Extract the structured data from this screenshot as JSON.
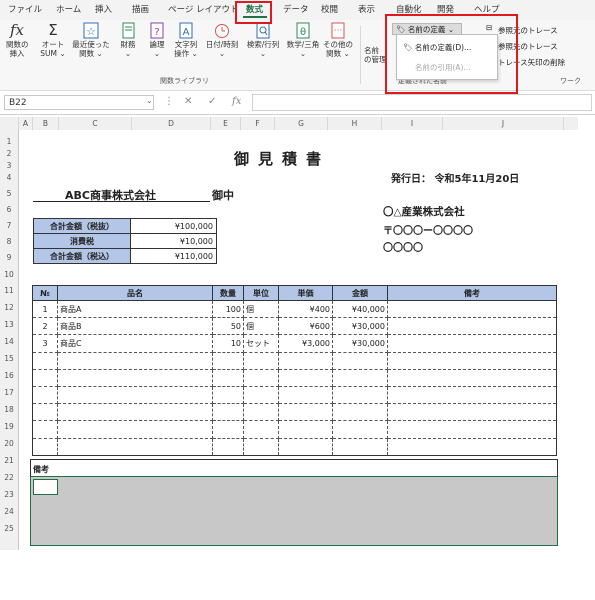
{
  "tabs": [
    "ファイル",
    "ホーム",
    "挿入",
    "描画",
    "ページ レイアウト",
    "数式",
    "データ",
    "校閲",
    "表示",
    "自動化",
    "開発",
    "ヘルプ"
  ],
  "ribbon": {
    "function_buttons": [
      "関数の\n挿入",
      "オート\nSUM ⌄",
      "最近使った\n関数 ⌄",
      "財務\n⌄",
      "論理\n⌄",
      "文字列\n操作 ⌄",
      "日付/時刻\n⌄",
      "検索/行列\n⌄",
      "数学/三角\n⌄",
      "その他の\n関数 ⌄"
    ],
    "function_group_label": "関数ライブラリ",
    "name_manager_partial": "名前\nの管理",
    "define_name_button": "名前の定義",
    "trace_precedents": "参照元のトレース",
    "trace_dependents": "参照先のトレース",
    "remove_arrows": "トレース矢印の削除",
    "defined_names_label": "定義された名前",
    "watch_partial": "ワーク",
    "dropdown_items": [
      "名前の定義(D)...",
      "名前の引用(A)..."
    ]
  },
  "formula_bar": {
    "name_box": "B22",
    "fx": "fx"
  },
  "columns": [
    "A",
    "B",
    "C",
    "D",
    "E",
    "F",
    "G",
    "H",
    "I",
    "J"
  ],
  "rows": [
    "1",
    "2",
    "3",
    "4",
    "5",
    "6",
    "7",
    "8",
    "9",
    "10",
    "11",
    "12",
    "13",
    "14",
    "15",
    "16",
    "17",
    "18",
    "19",
    "20",
    "21",
    "22",
    "23",
    "24",
    "25"
  ],
  "sheet": {
    "title": "御見積書",
    "issue_label": "発行日：",
    "issue_date": "令和5年11月20日",
    "customer": "ABC商事株式会社",
    "honorific": "御中",
    "company": "〇△産業株式会社",
    "postal": "〒〇〇〇ー〇〇〇〇",
    "address": "〇〇〇〇",
    "totals": [
      {
        "label": "合計金額（税抜）",
        "value": "¥100,000"
      },
      {
        "label": "消費税",
        "value": "¥10,000"
      },
      {
        "label": "合計金額（税込）",
        "value": "¥110,000"
      }
    ],
    "item_headers": [
      "№",
      "品名",
      "数量",
      "単位",
      "単価",
      "金額",
      "備考"
    ],
    "items": [
      {
        "no": "1",
        "name": "商品A",
        "qty": "100",
        "unit": "個",
        "price": "¥400",
        "amount": "¥40,000"
      },
      {
        "no": "2",
        "name": "商品B",
        "qty": "50",
        "unit": "個",
        "price": "¥600",
        "amount": "¥30,000"
      },
      {
        "no": "3",
        "name": "商品C",
        "qty": "10",
        "unit": "セット",
        "price": "¥3,000",
        "amount": "¥30,000"
      }
    ],
    "remarks_label": "備考"
  },
  "colors": {
    "header_fill": "#b4c6e7",
    "remarks_fill": "#c8c8c8",
    "highlight": "#e0191e",
    "selected_tab": "#217346"
  }
}
